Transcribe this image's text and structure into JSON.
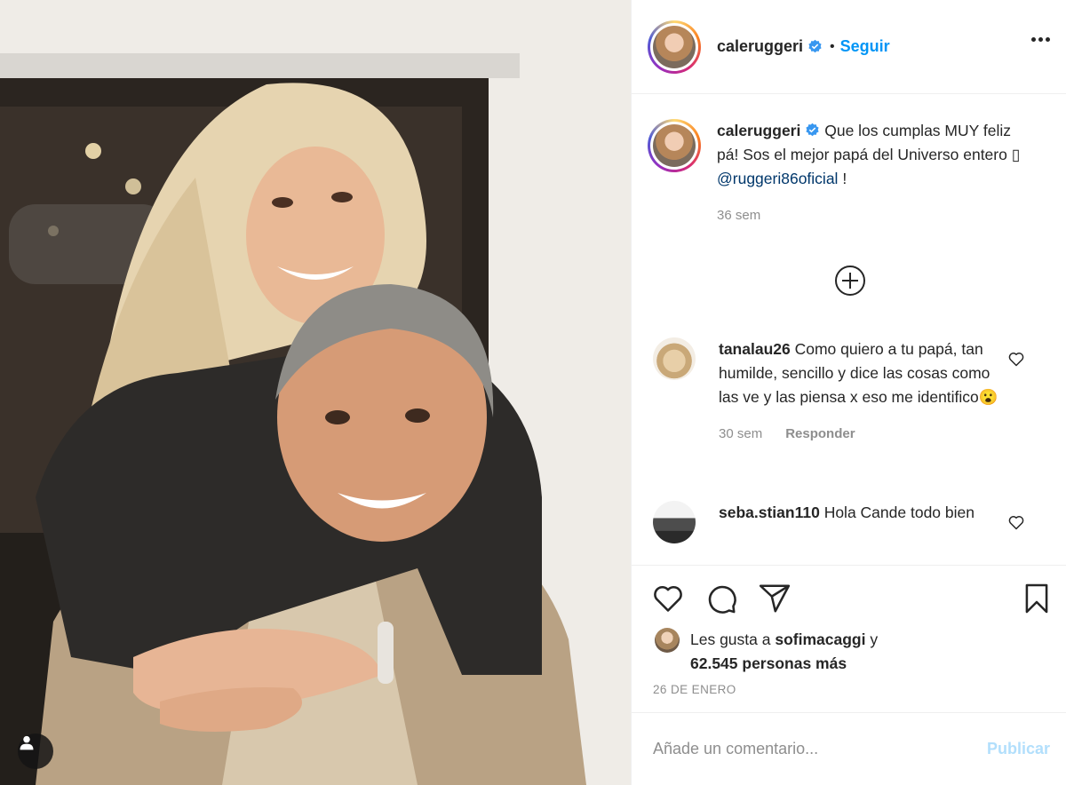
{
  "post": {
    "header": {
      "username": "caleruggeri",
      "separator": "•",
      "follow_label": "Seguir"
    },
    "caption": {
      "username": "caleruggeri",
      "text_before": " Que los cumplas MUY feliz pá! Sos el mejor papá del Universo entero ",
      "emoji": "▯",
      "mention": "@ruggeri86oficial",
      "text_after": " !",
      "time": "36 sem"
    },
    "comments": [
      {
        "username": "tanalau26",
        "text": " Como quiero a tu papá, tan humilde, sencillo y dice las cosas como las ve y las piensa x eso me identifico",
        "emoji": "😮",
        "time": "30 sem",
        "reply_label": "Responder"
      },
      {
        "username": "seba.stian110",
        "text": " Hola Cande todo bien"
      }
    ],
    "likes": {
      "prefix": "Les gusta a ",
      "user": "sofimacaggi",
      "middle": " y",
      "count": "62.545 personas más"
    },
    "date": "26 DE ENERO",
    "add_comment": {
      "placeholder": "Añade un comentario...",
      "post_label": "Publicar"
    }
  },
  "icons": {
    "verified": "verified-badge-icon",
    "more": "more-options-icon",
    "load_more": "plus-circle-icon",
    "like": "heart-icon",
    "comment": "comment-bubble-icon",
    "share": "paper-plane-icon",
    "save": "bookmark-icon",
    "tag": "user-tag-icon"
  },
  "colors": {
    "link_blue": "#0095f6",
    "mention_blue": "#00376b",
    "muted": "#8e8e8e",
    "publish_disabled": "#b2dffc"
  }
}
